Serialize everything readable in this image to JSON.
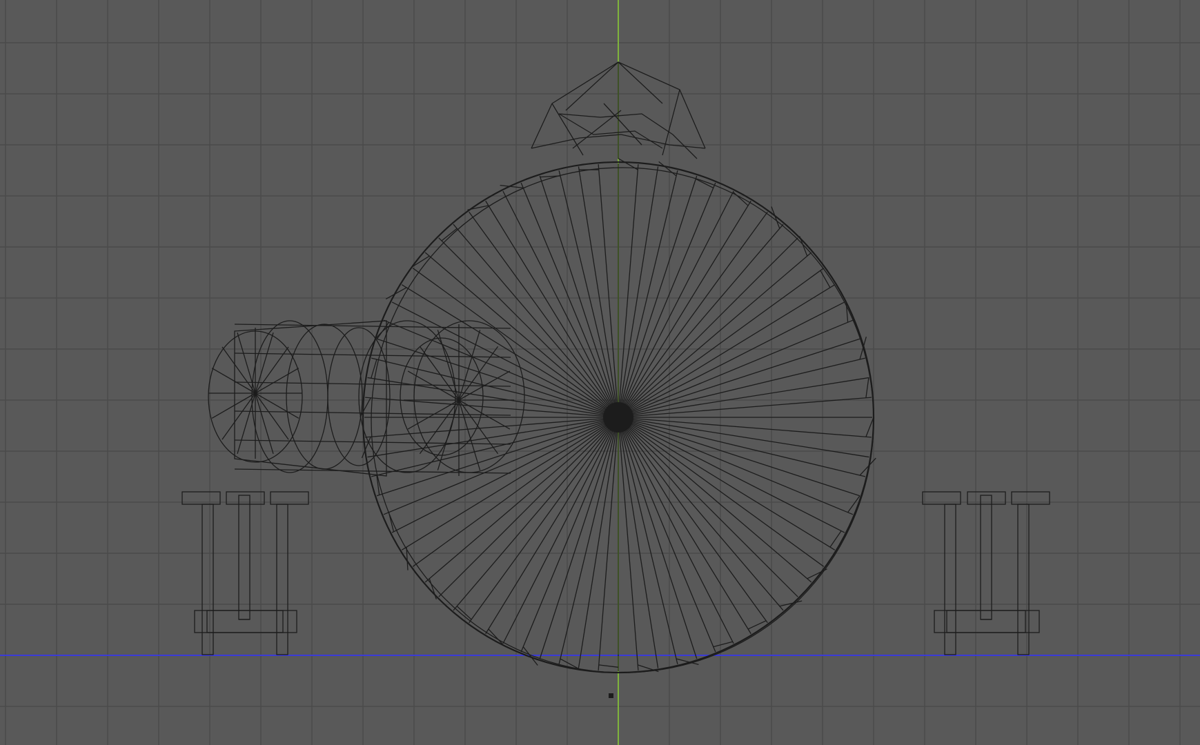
{
  "viewport": {
    "kind": "3d-viewport-wireframe",
    "background_color": "#595959",
    "grid_color": "#4a4a4a",
    "wire_color": "#1c1c1c",
    "axis_vertical_color": "#7fb43c",
    "axis_horizontal_color": "#3a3ad8"
  },
  "objects": [
    {
      "id": "sphere-body",
      "kind": "wireframe-sphere"
    },
    {
      "id": "top-cap",
      "kind": "wireframe-cone"
    },
    {
      "id": "side-cylinder",
      "kind": "wireframe-cylinder"
    },
    {
      "id": "left-stool",
      "kind": "wireframe-stand"
    },
    {
      "id": "right-stool",
      "kind": "wireframe-stand"
    },
    {
      "id": "origin-marker",
      "kind": "point"
    }
  ]
}
